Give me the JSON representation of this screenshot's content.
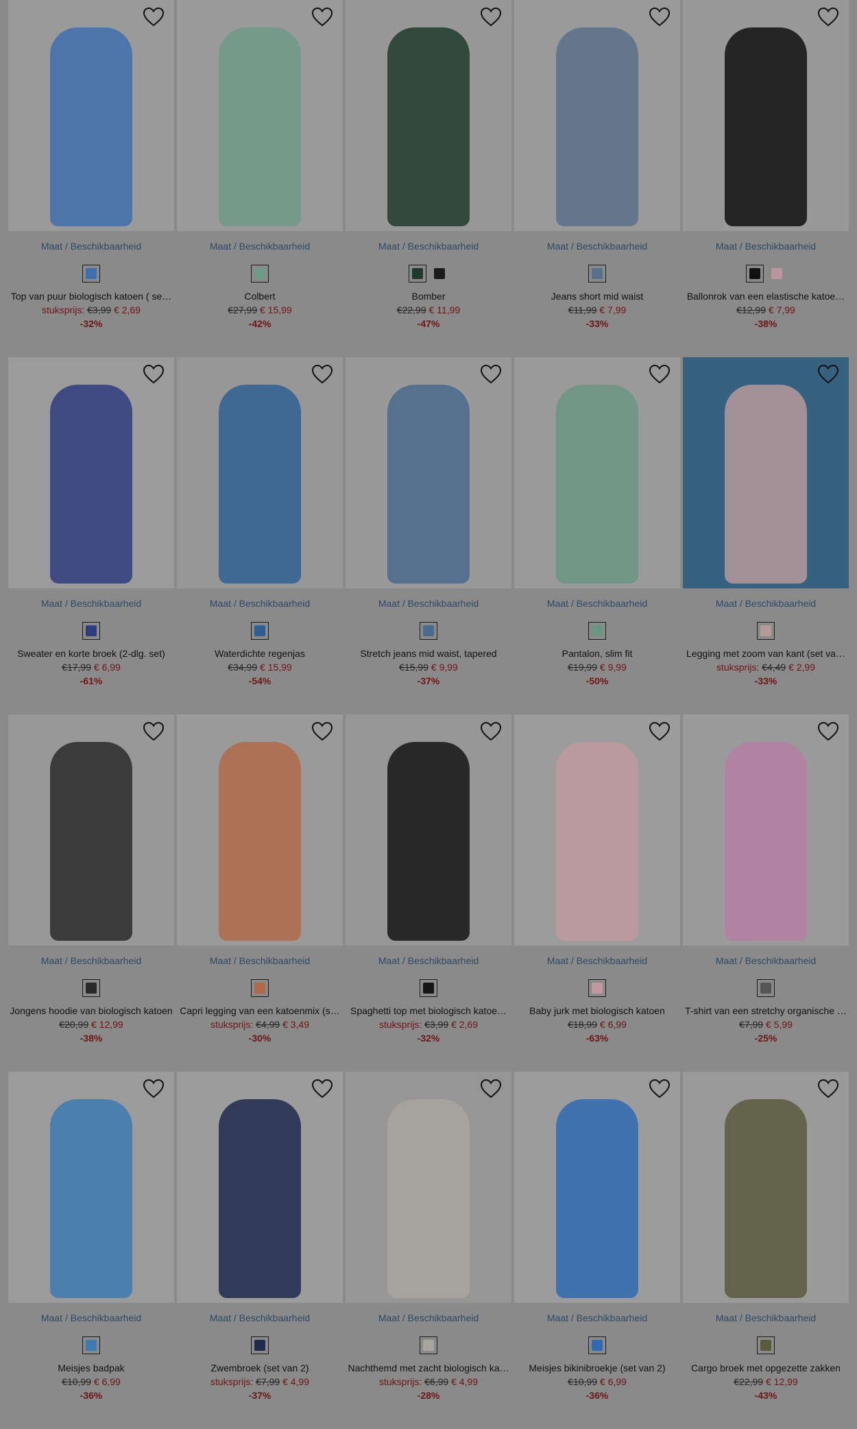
{
  "maat_label": "Maat / Beschikbaarheid",
  "stuks_label": "stuksprijs:",
  "products": [
    {
      "name": "Top van puur biologisch katoen ( se…",
      "label": true,
      "old": "€3,99",
      "new": "€ 2,69",
      "disc": "-32%",
      "bg": "#9a9a9a",
      "shape": "#3f6fae",
      "swatches": [
        "#3f6fae"
      ]
    },
    {
      "name": "Colbert",
      "label": false,
      "old": "€27,99",
      "new": "€ 15,99",
      "disc": "-42%",
      "bg": "#9a9a9a",
      "shape": "#6e9a88",
      "swatches": [
        "#6e9a88"
      ]
    },
    {
      "name": "Bomber",
      "label": false,
      "old": "€22,99",
      "new": "€ 11,99",
      "disc": "-47%",
      "bg": "#979797",
      "shape": "#1f3a2c",
      "swatches": [
        "#1f3a2c",
        "#1b1b1b"
      ]
    },
    {
      "name": "Jeans short mid waist",
      "label": false,
      "old": "€11,99",
      "new": "€ 7,99",
      "disc": "-33%",
      "bg": "#9a9a9a",
      "shape": "#59708a",
      "swatches": [
        "#59708a"
      ]
    },
    {
      "name": "Ballonrok van een elastische katoe…",
      "label": false,
      "old": "€12,99",
      "new": "€ 7,99",
      "disc": "-38%",
      "bg": "#999999",
      "shape": "#111111",
      "swatches": [
        "#111111",
        "#b9969d"
      ]
    },
    {
      "name": "Sweater en korte broek (2-dlg. set)",
      "label": false,
      "old": "€17,99",
      "new": "€ 6,99",
      "disc": "-61%",
      "bg": "#9b9b9b",
      "shape": "#2d3d7e",
      "swatches": [
        "#2d3d7e"
      ]
    },
    {
      "name": "Waterdichte regenjas",
      "label": false,
      "old": "€34,99",
      "new": "€ 15,99",
      "disc": "-54%",
      "bg": "#979797",
      "shape": "#2f5f92",
      "swatches": [
        "#2f5f92"
      ]
    },
    {
      "name": "Stretch jeans mid waist, tapered",
      "label": false,
      "old": "€15,99",
      "new": "€ 9,99",
      "disc": "-37%",
      "bg": "#999999",
      "shape": "#4a6a8e",
      "swatches": [
        "#4a6a8e"
      ]
    },
    {
      "name": "Pantalon, slim fit",
      "label": false,
      "old": "€19,99",
      "new": "€ 9,99",
      "disc": "-50%",
      "bg": "#9a9a9a",
      "shape": "#6b9583",
      "swatches": [
        "#6b9583"
      ]
    },
    {
      "name": "Legging met zoom van kant (set va…",
      "label": true,
      "old": "€4,49",
      "new": "€ 2,99",
      "disc": "-33%",
      "bg": "#36617f",
      "shape": "#b59a9a",
      "swatches": [
        "#b59a9a"
      ]
    },
    {
      "name": "Jongens hoodie van biologisch katoen",
      "label": false,
      "old": "€20,99",
      "new": "€ 12,99",
      "disc": "-38%",
      "bg": "#989898",
      "shape": "#2a2a2a",
      "swatches": [
        "#2a2a2a"
      ]
    },
    {
      "name": "Capri legging van een katoenmix (s…",
      "label": true,
      "old": "€4,99",
      "new": "€ 3,49",
      "disc": "-30%",
      "bg": "#9a9a9a",
      "shape": "#b06a4a",
      "swatches": [
        "#b06a4a"
      ]
    },
    {
      "name": "Spaghetti top met biologisch katoe…",
      "label": true,
      "old": "€3,99",
      "new": "€ 2,69",
      "disc": "-32%",
      "bg": "#979797",
      "shape": "#151515",
      "swatches": [
        "#151515"
      ]
    },
    {
      "name": "Baby jurk met biologisch katoen",
      "label": false,
      "old": "€18,99",
      "new": "€ 6,99",
      "disc": "-63%",
      "bg": "#9c9c9c",
      "shape": "#c09a9f",
      "swatches": [
        "#c09a9f"
      ]
    },
    {
      "name": "T-shirt van een stretchy organische …",
      "label": false,
      "old": "€7,99",
      "new": "€ 5,99",
      "disc": "-25%",
      "bg": "#9a9a9a",
      "shape": "#b57ea3",
      "swatches": [
        "#555555"
      ]
    },
    {
      "name": "Meisjes badpak",
      "label": false,
      "old": "€10,99",
      "new": "€ 6,99",
      "disc": "-36%",
      "bg": "#9b9b9b",
      "shape": "#3d7bb1",
      "swatches": [
        "#3d7bb1"
      ]
    },
    {
      "name": "Zwembroek (set van 2)",
      "label": true,
      "old": "€7,99",
      "new": "€ 4,99",
      "disc": "-37%",
      "bg": "#9c9c9c",
      "shape": "#1e2a4e",
      "swatches": [
        "#1e2a4e"
      ]
    },
    {
      "name": "Nachthemd met zacht biologisch ka…",
      "label": true,
      "old": "€6,99",
      "new": "€ 4,99",
      "disc": "-28%",
      "bg": "#969696",
      "shape": "#a9a6a0",
      "swatches": [
        "#a9a6a0"
      ]
    },
    {
      "name": "Meisjes bikinibroekje (set van 2)",
      "label": false,
      "old": "€10,99",
      "new": "€ 6,99",
      "disc": "-36%",
      "bg": "#9c9c9c",
      "shape": "#2f6bb2",
      "swatches": [
        "#2f6bb2"
      ]
    },
    {
      "name": "Cargo broek met opgezette zakken",
      "label": false,
      "old": "€22,99",
      "new": "€ 12,99",
      "disc": "-43%",
      "bg": "#9a9a9a",
      "shape": "#5a5a3e",
      "swatches": [
        "#5a5a3e"
      ]
    }
  ]
}
